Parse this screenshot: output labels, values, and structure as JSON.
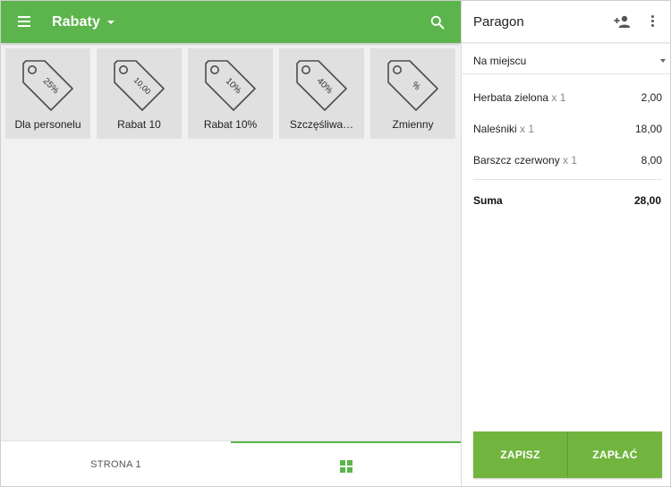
{
  "appbar": {
    "title": "Rabaty"
  },
  "tiles": [
    {
      "label": "Dla personelu",
      "tag_text": "25%"
    },
    {
      "label": "Rabat 10",
      "tag_text": "10,00"
    },
    {
      "label": "Rabat 10%",
      "tag_text": "10%"
    },
    {
      "label": "Szczęśliwa…",
      "tag_text": "40%"
    },
    {
      "label": "Zmienny",
      "tag_text": "%"
    }
  ],
  "bottom": {
    "page_tab": "STRONA 1"
  },
  "receipt": {
    "title": "Paragon",
    "order_type": "Na miejscu",
    "items": [
      {
        "name": "Herbata zielona",
        "qty": "x 1",
        "price": "2,00"
      },
      {
        "name": "Naleśniki",
        "qty": "x 1",
        "price": "18,00"
      },
      {
        "name": "Barszcz czerwony",
        "qty": "x 1",
        "price": "8,00"
      }
    ],
    "sum_label": "Suma",
    "sum_value": "28,00",
    "save_label": "ZAPISZ",
    "pay_label": "ZAPŁAĆ"
  },
  "colors": {
    "accent": "#5cb54c",
    "button": "#71b53f",
    "tile": "#e0e0e0"
  },
  "icons": [
    "menu-icon",
    "search-icon",
    "tag-icon",
    "grid-icon",
    "add-person-icon",
    "more-vert-icon",
    "dropdown-caret-icon"
  ]
}
